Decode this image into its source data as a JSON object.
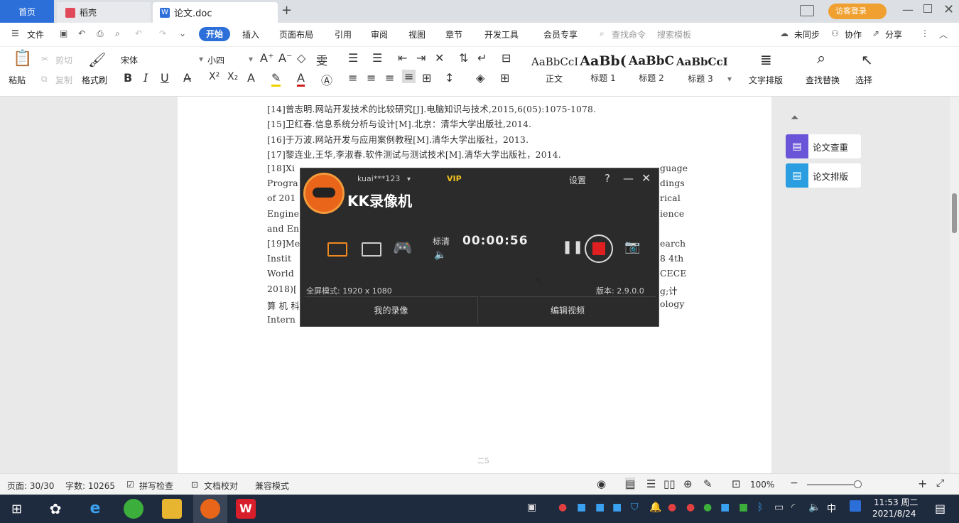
{
  "tabs": {
    "home": "首页",
    "daoke": "稻壳",
    "doc": "论文.doc",
    "add": "+"
  },
  "titlebar": {
    "user_badge": "访客登录"
  },
  "menu": {
    "file": "文件",
    "start": "开始",
    "insert": "插入",
    "layout": "页面布局",
    "reference": "引用",
    "review": "审阅",
    "view": "视图",
    "section": "章节",
    "devtools": "开发工具",
    "member": "会员专享",
    "find_cmd": "查找命令",
    "search_tpl": "搜索模板",
    "unsync": "未同步",
    "collab": "协作",
    "share": "分享"
  },
  "ribbon": {
    "paste": "粘贴",
    "cut": "剪切",
    "copy": "复制",
    "format_painter": "格式刷",
    "font_name": "宋体",
    "font_size": "小四",
    "styles": [
      {
        "preview": "AaBbCcI",
        "name": "正文"
      },
      {
        "preview": "AaBb(",
        "name": "标题 1"
      },
      {
        "preview": "AaBbC",
        "name": "标题 2"
      },
      {
        "preview": "AaBbCcI",
        "name": "标题 3"
      }
    ],
    "text_layout": "文字排版",
    "find_replace": "查找替换",
    "select": "选择"
  },
  "document": {
    "lines": [
      "[14]曾志明.网站开发技术的比较研究[J].电脑知识与技术,2015,6(05):1075-1078.",
      "[15]卫红春.信息系统分析与设计[M].北京：清华大学出版社,2014.",
      "[16]于万波.网站开发与应用案例教程[M].清华大学出版社，2013.",
      "[17]黎连业,王华,李淑春.软件测试与测试技术[M].清华大学出版社，2014.",
      "[18]Xi",
      "Progra",
      "of 201",
      "Engine",
      "and En",
      "[19]Me",
      "Instit",
      "World",
      "2018)[",
      "算 机 科",
      "Intern"
    ],
    "right_frags": [
      "guage",
      "dings",
      "rical",
      "ience",
      "",
      "earch",
      "8 4th",
      "CECE",
      "g;计",
      "ology"
    ],
    "footer": "二5"
  },
  "right_panel": {
    "check": "论文查重",
    "format": "论文排版"
  },
  "kk": {
    "user": "kuai***123",
    "vip": "VIP",
    "settings": "设置",
    "help": "?",
    "title": "KK录像机",
    "quality": "标清",
    "timer": "00:00:56",
    "mode": "全屏模式: 1920 x 1080",
    "version": "版本: 2.9.0.0",
    "my_videos": "我的录像",
    "edit_video": "编辑视频"
  },
  "statusbar": {
    "page": "页面: 30/30",
    "words": "字数: 10265",
    "spellcheck": "拼写检查",
    "proof": "文档校对",
    "compat": "兼容模式",
    "zoom": "100%"
  },
  "taskbar": {
    "time": "11:53 周二",
    "date": "2021/8/24",
    "ime": "中"
  }
}
